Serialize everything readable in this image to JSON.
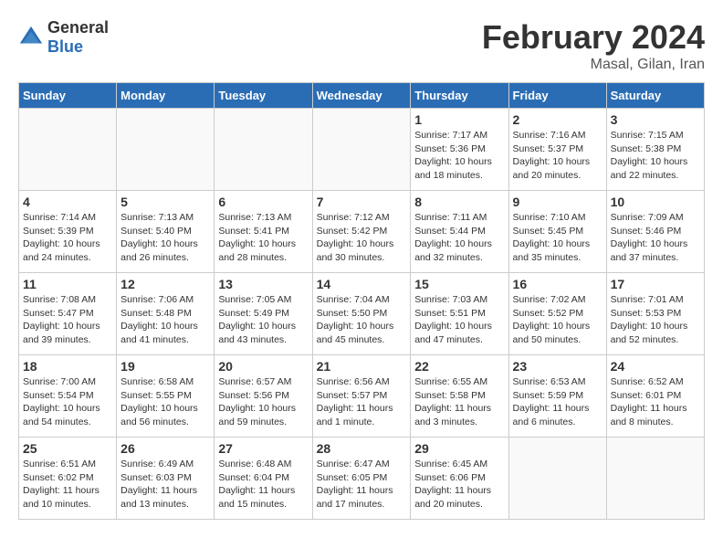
{
  "header": {
    "logo_general": "General",
    "logo_blue": "Blue",
    "month_title": "February 2024",
    "location": "Masal, Gilan, Iran"
  },
  "days_of_week": [
    "Sunday",
    "Monday",
    "Tuesday",
    "Wednesday",
    "Thursday",
    "Friday",
    "Saturday"
  ],
  "weeks": [
    [
      {
        "day": "",
        "info": ""
      },
      {
        "day": "",
        "info": ""
      },
      {
        "day": "",
        "info": ""
      },
      {
        "day": "",
        "info": ""
      },
      {
        "day": "1",
        "info": "Sunrise: 7:17 AM\nSunset: 5:36 PM\nDaylight: 10 hours and 18 minutes."
      },
      {
        "day": "2",
        "info": "Sunrise: 7:16 AM\nSunset: 5:37 PM\nDaylight: 10 hours and 20 minutes."
      },
      {
        "day": "3",
        "info": "Sunrise: 7:15 AM\nSunset: 5:38 PM\nDaylight: 10 hours and 22 minutes."
      }
    ],
    [
      {
        "day": "4",
        "info": "Sunrise: 7:14 AM\nSunset: 5:39 PM\nDaylight: 10 hours and 24 minutes."
      },
      {
        "day": "5",
        "info": "Sunrise: 7:13 AM\nSunset: 5:40 PM\nDaylight: 10 hours and 26 minutes."
      },
      {
        "day": "6",
        "info": "Sunrise: 7:13 AM\nSunset: 5:41 PM\nDaylight: 10 hours and 28 minutes."
      },
      {
        "day": "7",
        "info": "Sunrise: 7:12 AM\nSunset: 5:42 PM\nDaylight: 10 hours and 30 minutes."
      },
      {
        "day": "8",
        "info": "Sunrise: 7:11 AM\nSunset: 5:44 PM\nDaylight: 10 hours and 32 minutes."
      },
      {
        "day": "9",
        "info": "Sunrise: 7:10 AM\nSunset: 5:45 PM\nDaylight: 10 hours and 35 minutes."
      },
      {
        "day": "10",
        "info": "Sunrise: 7:09 AM\nSunset: 5:46 PM\nDaylight: 10 hours and 37 minutes."
      }
    ],
    [
      {
        "day": "11",
        "info": "Sunrise: 7:08 AM\nSunset: 5:47 PM\nDaylight: 10 hours and 39 minutes."
      },
      {
        "day": "12",
        "info": "Sunrise: 7:06 AM\nSunset: 5:48 PM\nDaylight: 10 hours and 41 minutes."
      },
      {
        "day": "13",
        "info": "Sunrise: 7:05 AM\nSunset: 5:49 PM\nDaylight: 10 hours and 43 minutes."
      },
      {
        "day": "14",
        "info": "Sunrise: 7:04 AM\nSunset: 5:50 PM\nDaylight: 10 hours and 45 minutes."
      },
      {
        "day": "15",
        "info": "Sunrise: 7:03 AM\nSunset: 5:51 PM\nDaylight: 10 hours and 47 minutes."
      },
      {
        "day": "16",
        "info": "Sunrise: 7:02 AM\nSunset: 5:52 PM\nDaylight: 10 hours and 50 minutes."
      },
      {
        "day": "17",
        "info": "Sunrise: 7:01 AM\nSunset: 5:53 PM\nDaylight: 10 hours and 52 minutes."
      }
    ],
    [
      {
        "day": "18",
        "info": "Sunrise: 7:00 AM\nSunset: 5:54 PM\nDaylight: 10 hours and 54 minutes."
      },
      {
        "day": "19",
        "info": "Sunrise: 6:58 AM\nSunset: 5:55 PM\nDaylight: 10 hours and 56 minutes."
      },
      {
        "day": "20",
        "info": "Sunrise: 6:57 AM\nSunset: 5:56 PM\nDaylight: 10 hours and 59 minutes."
      },
      {
        "day": "21",
        "info": "Sunrise: 6:56 AM\nSunset: 5:57 PM\nDaylight: 11 hours and 1 minute."
      },
      {
        "day": "22",
        "info": "Sunrise: 6:55 AM\nSunset: 5:58 PM\nDaylight: 11 hours and 3 minutes."
      },
      {
        "day": "23",
        "info": "Sunrise: 6:53 AM\nSunset: 5:59 PM\nDaylight: 11 hours and 6 minutes."
      },
      {
        "day": "24",
        "info": "Sunrise: 6:52 AM\nSunset: 6:01 PM\nDaylight: 11 hours and 8 minutes."
      }
    ],
    [
      {
        "day": "25",
        "info": "Sunrise: 6:51 AM\nSunset: 6:02 PM\nDaylight: 11 hours and 10 minutes."
      },
      {
        "day": "26",
        "info": "Sunrise: 6:49 AM\nSunset: 6:03 PM\nDaylight: 11 hours and 13 minutes."
      },
      {
        "day": "27",
        "info": "Sunrise: 6:48 AM\nSunset: 6:04 PM\nDaylight: 11 hours and 15 minutes."
      },
      {
        "day": "28",
        "info": "Sunrise: 6:47 AM\nSunset: 6:05 PM\nDaylight: 11 hours and 17 minutes."
      },
      {
        "day": "29",
        "info": "Sunrise: 6:45 AM\nSunset: 6:06 PM\nDaylight: 11 hours and 20 minutes."
      },
      {
        "day": "",
        "info": ""
      },
      {
        "day": "",
        "info": ""
      }
    ]
  ]
}
